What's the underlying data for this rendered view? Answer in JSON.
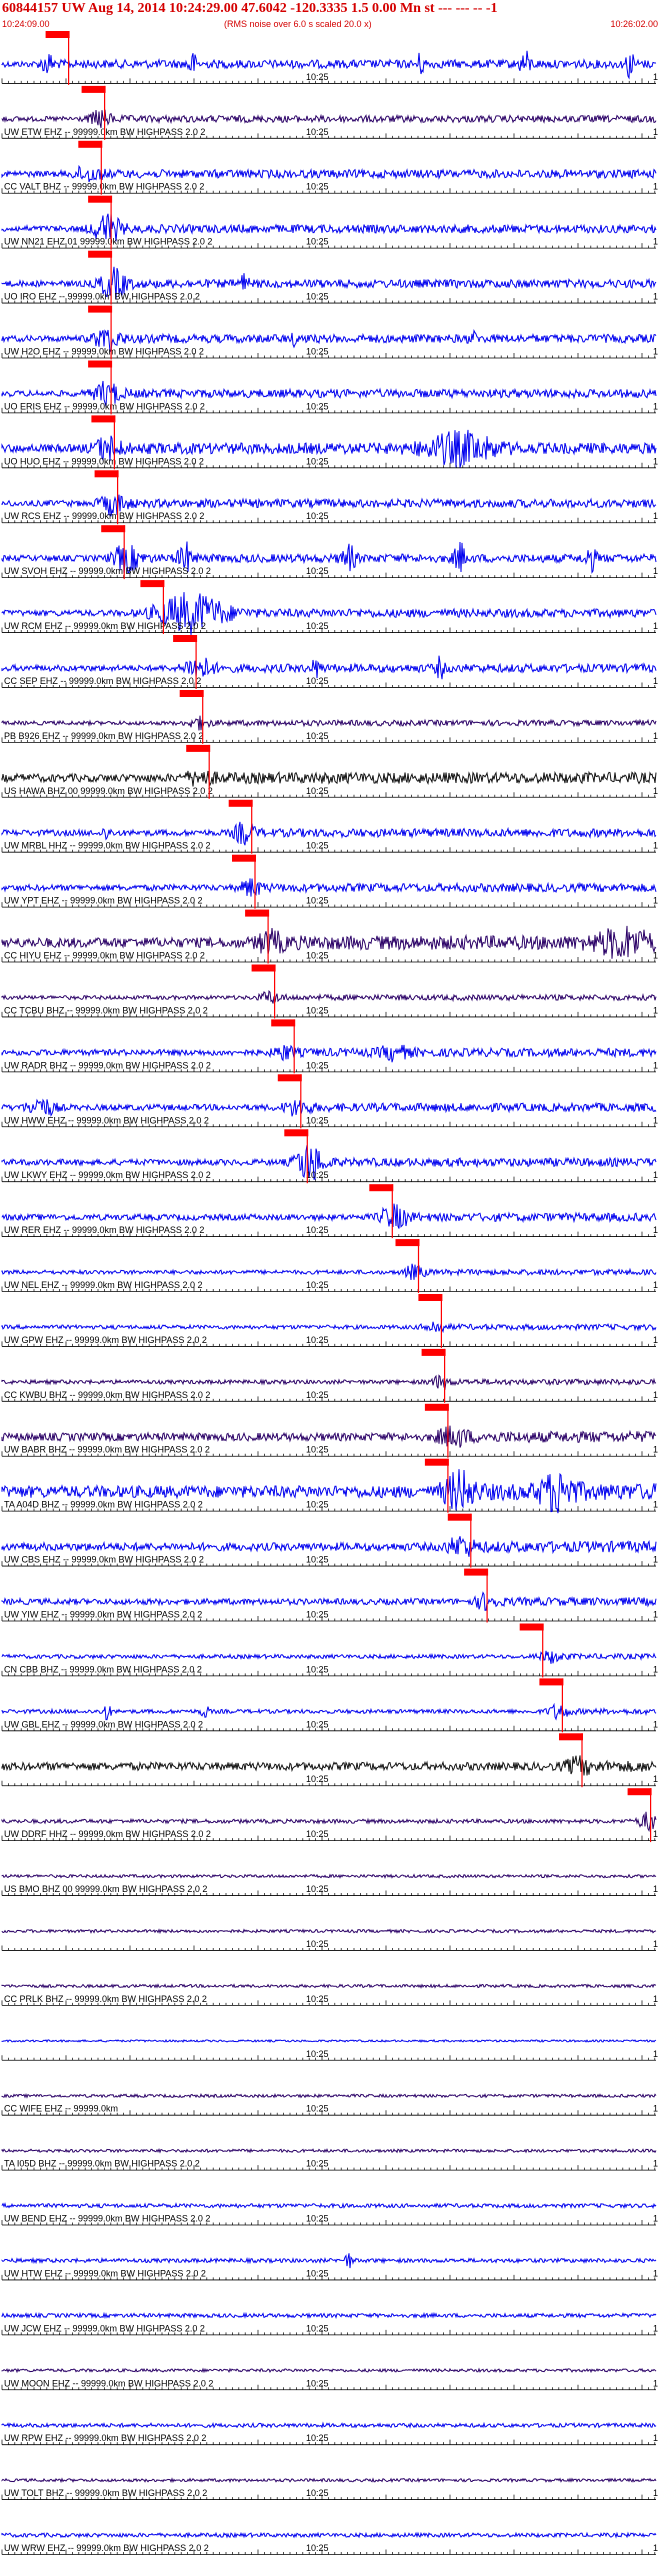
{
  "header": {
    "title": "60844157 UW Aug 14, 2014 10:24:29.00   47.6042 -120.3335  1.5 0.00 Mn st --- --- --  -1",
    "start_time": "10:24:09.00",
    "noise_note": "(RMS noise over 6.0 s scaled 20.0 x)",
    "end_time": "10:26:02.00"
  },
  "chart_data": {
    "type": "seismogram",
    "title": "60844157 UW Aug 14, 2014 10:24:29.00   47.6042 -120.3335  1.5 0.00 Mn st --- --- --  -1",
    "x_start": "10:24:09.00",
    "x_end": "10:26:02.00",
    "x_mid_label": "10:25",
    "right_label": "1",
    "colors": {
      "blue": "#0000ee",
      "purple": "#2a0066",
      "black": "#111111",
      "pick": "#ff0000",
      "header": "#d40000"
    },
    "traces": [
      {
        "label": "",
        "color": "blue",
        "amp": 3,
        "bursts": [
          {
            "t": 0.07,
            "a": 10,
            "w": 0.01
          },
          {
            "t": 0.29,
            "a": 12,
            "w": 0.006
          },
          {
            "t": 0.64,
            "a": 9,
            "w": 0.006
          },
          {
            "t": 0.8,
            "a": 11,
            "w": 0.008
          },
          {
            "t": 0.96,
            "a": 13,
            "w": 0.006
          }
        ],
        "pick": 0.085
      },
      {
        "label": "UW ETW EHZ -- 99999.0km BW  HIGHPASS  2.0  2",
        "color": "purple",
        "amp": 2.5,
        "bursts": [
          {
            "t": 0.15,
            "a": 8,
            "w": 0.015
          }
        ],
        "pick": 0.14
      },
      {
        "label": "CC VALT BHZ -- 99999.0km BW  HIGHPASS  2.0  2",
        "color": "blue",
        "amp": 3,
        "bursts": [
          {
            "t": 0.13,
            "a": 7,
            "w": 0.02
          }
        ],
        "pick": 0.135
      },
      {
        "label": "UW NN21 EHZ 01 99999.0km BW  HIGHPASS  2.0  2",
        "color": "blue",
        "amp": 3,
        "bursts": [
          {
            "t": 0.16,
            "a": 14,
            "w": 0.02
          }
        ],
        "pick": 0.15
      },
      {
        "label": "UO IRO EHZ -- 99999.0km BW  HIGHPASS  2.0  2",
        "color": "blue",
        "amp": 3,
        "bursts": [
          {
            "t": 0.17,
            "a": 13,
            "w": 0.02
          },
          {
            "t": 0.37,
            "a": 8,
            "w": 0.006
          }
        ],
        "pick": 0.15
      },
      {
        "label": "UW H2O EHZ -- 99999.0km BW  HIGHPASS  2.0  2",
        "color": "blue",
        "amp": 3,
        "bursts": [
          {
            "t": 0.16,
            "a": 10,
            "w": 0.02
          },
          {
            "t": 0.45,
            "a": 6,
            "w": 0.006
          },
          {
            "t": 0.72,
            "a": 5,
            "w": 0.006
          }
        ],
        "pick": 0.15
      },
      {
        "label": "UO ERIS EHZ -- 99999.0km BW  HIGHPASS  2.0  2",
        "color": "blue",
        "amp": 3,
        "bursts": [
          {
            "t": 0.16,
            "a": 10,
            "w": 0.02
          }
        ],
        "pick": 0.15
      },
      {
        "label": "UO HUO EHZ -- 99999.0km BW  HIGHPASS  2.0  2",
        "color": "blue",
        "amp": 4,
        "bursts": [
          {
            "t": 0.16,
            "a": 10,
            "w": 0.02
          },
          {
            "t": 0.7,
            "a": 14,
            "w": 0.05
          }
        ],
        "pick": 0.155
      },
      {
        "label": "UW RCS EHZ -- 99999.0km BW  HIGHPASS  2.0  2",
        "color": "blue",
        "amp": 3,
        "bursts": [
          {
            "t": 0.17,
            "a": 9,
            "w": 0.02
          }
        ],
        "pick": 0.16
      },
      {
        "label": "UW SVOH EHZ -- 99999.0km BW  HIGHPASS  2.0  2",
        "color": "blue",
        "amp": 3,
        "bursts": [
          {
            "t": 0.19,
            "a": 12,
            "w": 0.02
          },
          {
            "t": 0.28,
            "a": 14,
            "w": 0.01
          },
          {
            "t": 0.53,
            "a": 12,
            "w": 0.01
          },
          {
            "t": 0.7,
            "a": 14,
            "w": 0.008
          },
          {
            "t": 0.9,
            "a": 11,
            "w": 0.008
          }
        ],
        "pick": 0.17
      },
      {
        "label": "UW RCM EHZ -- 99999.0km BW  HIGHPASS  2.0  2",
        "color": "blue",
        "amp": 3,
        "bursts": [
          {
            "t": 0.29,
            "a": 18,
            "w": 0.05
          }
        ],
        "pick": 0.23
      },
      {
        "label": "CC SEP EHZ -- 99999.0km BW  HIGHPASS  2.0  2",
        "color": "blue",
        "amp": 3,
        "bursts": [
          {
            "t": 0.3,
            "a": 10,
            "w": 0.02
          },
          {
            "t": 0.48,
            "a": 8,
            "w": 0.006
          },
          {
            "t": 0.67,
            "a": 9,
            "w": 0.006
          }
        ],
        "pick": 0.28
      },
      {
        "label": "PB B926 EHZ -- 99999.0km BW  HIGHPASS  2.0  2",
        "color": "purple",
        "amp": 2,
        "bursts": [
          {
            "t": 0.3,
            "a": 5,
            "w": 0.015
          }
        ],
        "pick": 0.29
      },
      {
        "label": "US HAWA BHZ 00 99999.0km BW  HIGHPASS  2.0  2",
        "color": "black",
        "amp": 4,
        "bursts": [
          {
            "t": 0.3,
            "a": 6,
            "w": 0.02
          }
        ],
        "pick": 0.3
      },
      {
        "label": "UW MRBL HHZ -- 99999.0km BW  HIGHPASS  2.0  2",
        "color": "blue",
        "amp": 3,
        "bursts": [
          {
            "t": 0.37,
            "a": 10,
            "w": 0.015
          },
          {
            "t": 0.16,
            "a": 6,
            "w": 0.006
          }
        ],
        "pick": 0.365
      },
      {
        "label": "UW YPT EHZ -- 99999.0km BW  HIGHPASS  2.0  2",
        "color": "blue",
        "amp": 3,
        "bursts": [
          {
            "t": 0.38,
            "a": 7,
            "w": 0.015
          }
        ],
        "pick": 0.37
      },
      {
        "label": "CC HIYU EHZ -- 99999.0km BW  HIGHPASS  2.0  2",
        "color": "purple",
        "amp": 5,
        "bursts": [
          {
            "t": 0.95,
            "a": 12,
            "w": 0.04
          },
          {
            "t": 0.41,
            "a": 8,
            "w": 0.02
          }
        ],
        "pick": 0.39
      },
      {
        "label": "CC TCBU BHZ -- 99999.0km BW  HIGHPASS  2.0  2",
        "color": "purple",
        "amp": 2,
        "bursts": [
          {
            "t": 0.41,
            "a": 5,
            "w": 0.015
          }
        ],
        "pick": 0.4
      },
      {
        "label": "UW RADR BHZ -- 99999.0km BW  HIGHPASS  2.0  2",
        "color": "blue",
        "amp": 3,
        "bursts": [
          {
            "t": 0.43,
            "a": 6,
            "w": 0.015
          },
          {
            "t": 0.6,
            "a": 6,
            "w": 0.02
          }
        ],
        "pick": 0.43
      },
      {
        "label": "UW HWW EHZ -- 99999.0km BW  HIGHPASS  2.0  2",
        "color": "blue",
        "amp": 3,
        "bursts": [
          {
            "t": 0.06,
            "a": 9,
            "w": 0.02
          },
          {
            "t": 0.45,
            "a": 6,
            "w": 0.02
          }
        ],
        "pick": 0.44
      },
      {
        "label": "UW LKWY EHZ -- 99999.0km BW  HIGHPASS  2.0  2",
        "color": "blue",
        "amp": 3,
        "bursts": [
          {
            "t": 0.47,
            "a": 18,
            "w": 0.02
          }
        ],
        "pick": 0.45
      },
      {
        "label": "UW RER EHZ -- 99999.0km BW  HIGHPASS  2.0  2",
        "color": "blue",
        "amp": 3,
        "bursts": [
          {
            "t": 0.6,
            "a": 10,
            "w": 0.02
          }
        ],
        "pick": 0.58
      },
      {
        "label": "UW NEL EHZ -- 99999.0km BW  HIGHPASS  2.0  2",
        "color": "blue",
        "amp": 2,
        "bursts": [
          {
            "t": 0.63,
            "a": 6,
            "w": 0.015
          }
        ],
        "pick": 0.62
      },
      {
        "label": "UW GPW EHZ -- 99999.0km BW  HIGHPASS  2.0  2",
        "color": "blue",
        "amp": 2,
        "bursts": [
          {
            "t": 0.66,
            "a": 5,
            "w": 0.015
          }
        ],
        "pick": 0.655
      },
      {
        "label": "CC KWBU BHZ -- 99999.0km BW  HIGHPASS  2.0  2",
        "color": "purple",
        "amp": 2,
        "bursts": [
          {
            "t": 0.67,
            "a": 5,
            "w": 0.015
          }
        ],
        "pick": 0.66
      },
      {
        "label": "UW BABR BHZ -- 99999.0km BW  HIGHPASS  2.0  2",
        "color": "purple",
        "amp": 4,
        "bursts": [
          {
            "t": 0.69,
            "a": 8,
            "w": 0.02
          }
        ],
        "pick": 0.665
      },
      {
        "label": "TA A04D BHZ -- 99999.0km BW  HIGHPASS  2.0  2",
        "color": "blue",
        "amp": 6,
        "bursts": [
          {
            "t": 0.7,
            "a": 16,
            "w": 0.02
          },
          {
            "t": 0.85,
            "a": 16,
            "w": 0.025
          }
        ],
        "pick": 0.665
      },
      {
        "label": "UW CBS EHZ -- 99999.0km BW  HIGHPASS  2.0  2",
        "color": "blue",
        "amp": 4,
        "bursts": [
          {
            "t": 0.7,
            "a": 8,
            "w": 0.02
          }
        ],
        "pick": 0.7
      },
      {
        "label": "UW YIW EHZ -- 99999.0km BW  HIGHPASS  2.0  2",
        "color": "blue",
        "amp": 3,
        "bursts": [
          {
            "t": 0.74,
            "a": 6,
            "w": 0.015
          }
        ],
        "pick": 0.725
      },
      {
        "label": "CN CBB BHZ -- 99999.0km BW  HIGHPASS  2.0  2",
        "color": "blue",
        "amp": 2,
        "bursts": [
          {
            "t": 0.84,
            "a": 5,
            "w": 0.015
          }
        ],
        "pick": 0.81
      },
      {
        "label": "UW GBL EHZ -- 99999.0km BW  HIGHPASS  2.0  2",
        "color": "blue",
        "amp": 2,
        "bursts": [
          {
            "t": 0.16,
            "a": 8,
            "w": 0.006
          },
          {
            "t": 0.31,
            "a": 6,
            "w": 0.006
          },
          {
            "t": 0.85,
            "a": 6,
            "w": 0.015
          }
        ],
        "pick": 0.84
      },
      {
        "label": "",
        "color": "black",
        "amp": 4,
        "bursts": [
          {
            "t": 0.88,
            "a": 6,
            "w": 0.02
          }
        ],
        "pick": 0.87
      },
      {
        "label": "UW DDRF HHZ -- 99999.0km BW  HIGHPASS  2.0  2",
        "color": "purple",
        "amp": 2,
        "bursts": [
          {
            "t": 0.99,
            "a": 8,
            "w": 0.015
          }
        ],
        "pick": 0.975
      },
      {
        "label": "US BMO BHZ 00 99999.0km BW  HIGHPASS  2.0  2",
        "color": "purple",
        "amp": 1.5,
        "bursts": [],
        "pick": null
      },
      {
        "label": "",
        "color": "purple",
        "amp": 1.5,
        "bursts": [],
        "pick": null
      },
      {
        "label": "CC PRLK BHZ -- 99999.0km BW  HIGHPASS  2.0  2",
        "color": "purple",
        "amp": 1.5,
        "bursts": [],
        "pick": null
      },
      {
        "label": "",
        "color": "blue",
        "amp": 1,
        "bursts": [],
        "pick": null
      },
      {
        "label": "CC WIFE EHZ -- 99999.0km",
        "color": "purple",
        "amp": 1.5,
        "bursts": [],
        "pick": null
      },
      {
        "label": "TA I05D BHZ -- 99999.0km BW  HIGHPASS  2.0  2",
        "color": "purple",
        "amp": 1.5,
        "bursts": [],
        "pick": null
      },
      {
        "label": "UW BEND EHZ -- 99999.0km BW  HIGHPASS  2.0  2",
        "color": "blue",
        "amp": 2,
        "bursts": [],
        "pick": null
      },
      {
        "label": "UW HTW EHZ -- 99999.0km BW  HIGHPASS  2.0  2",
        "color": "blue",
        "amp": 2,
        "bursts": [
          {
            "t": 0.53,
            "a": 7,
            "w": 0.006
          }
        ],
        "pick": null
      },
      {
        "label": "UW JCW EHZ -- 99999.0km BW  HIGHPASS  2.0  2",
        "color": "blue",
        "amp": 2,
        "bursts": [],
        "pick": null
      },
      {
        "label": "UW MOON EHZ -- 99999.0km BW  HIGHPASS  2.0  2",
        "color": "purple",
        "amp": 1.5,
        "bursts": [],
        "pick": null
      },
      {
        "label": "UW RPW EHZ -- 99999.0km BW  HIGHPASS  2.0  2",
        "color": "blue",
        "amp": 2,
        "bursts": [],
        "pick": null
      },
      {
        "label": "UW TOLT BHZ -- 99999.0km BW  HIGHPASS  2.0  2",
        "color": "purple",
        "amp": 1.5,
        "bursts": [],
        "pick": null
      },
      {
        "label": "UW WRW EHZ -- 99999.0km BW  HIGHPASS  2.0  2",
        "color": "blue",
        "amp": 2,
        "bursts": [],
        "pick": null
      }
    ]
  }
}
